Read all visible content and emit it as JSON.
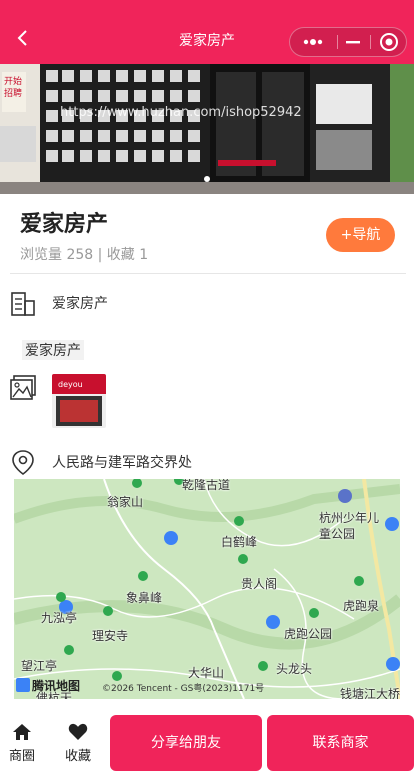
{
  "nav": {
    "title": "爱家房产"
  },
  "hero": {
    "watermark": "https://www.huzhan.com/ishop52942"
  },
  "shop": {
    "name": "爱家房产",
    "stats": "浏览量 258 | 收藏 1",
    "nav_button": "+导航"
  },
  "info": {
    "title": "爱家房产",
    "description": "爱家房产",
    "address": "人民路与建军路交界处"
  },
  "map": {
    "logo": "腾讯地图",
    "copyright": "©2026 Tencent - GS粤(2023)1171号",
    "labels": [
      "乾隆古道",
      "翁家山",
      "白鹤峰",
      "杭州少年儿童公园",
      "贵人阁",
      "象鼻峰",
      "九泓亭",
      "理安寺",
      "虎跑泉",
      "虎跑公园",
      "望江亭",
      "大华山",
      "头龙头",
      "钱塘江大桥",
      "佛杭天"
    ]
  },
  "bottom": {
    "tab_home": "商圈",
    "tab_fav": "收藏",
    "share": "分享给朋友",
    "contact": "联系商家"
  },
  "colors": {
    "brand": "#f0245a",
    "accent": "#ff7a3c"
  }
}
